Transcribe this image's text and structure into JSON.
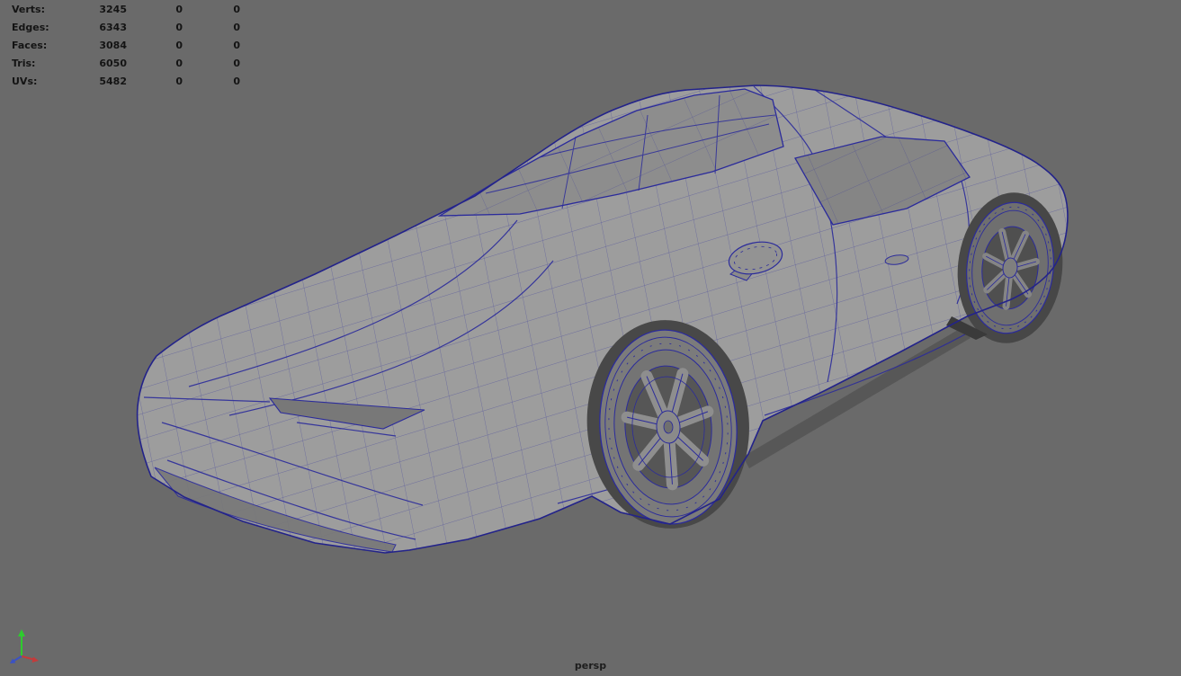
{
  "viewport": {
    "background_color": "#6a6a6a",
    "camera_label": "persp"
  },
  "hud": {
    "rows": [
      {
        "label": "Verts:",
        "values": [
          "3245",
          "0",
          "0"
        ]
      },
      {
        "label": "Edges:",
        "values": [
          "6343",
          "0",
          "0"
        ]
      },
      {
        "label": "Faces:",
        "values": [
          "3084",
          "0",
          "0"
        ]
      },
      {
        "label": "Tris:",
        "values": [
          "6050",
          "0",
          "0"
        ]
      },
      {
        "label": "UVs:",
        "values": [
          "5482",
          "0",
          "0"
        ]
      }
    ]
  },
  "axis_gizmo": {
    "colors": {
      "x": "#c43b3b",
      "y": "#2ecc2e",
      "z": "#3b52c4"
    }
  },
  "model": {
    "description": "sports car polygon mesh, shaded with wireframe",
    "wireframe_color": "#2b2b9b",
    "body_color": "#9d9d9d"
  }
}
